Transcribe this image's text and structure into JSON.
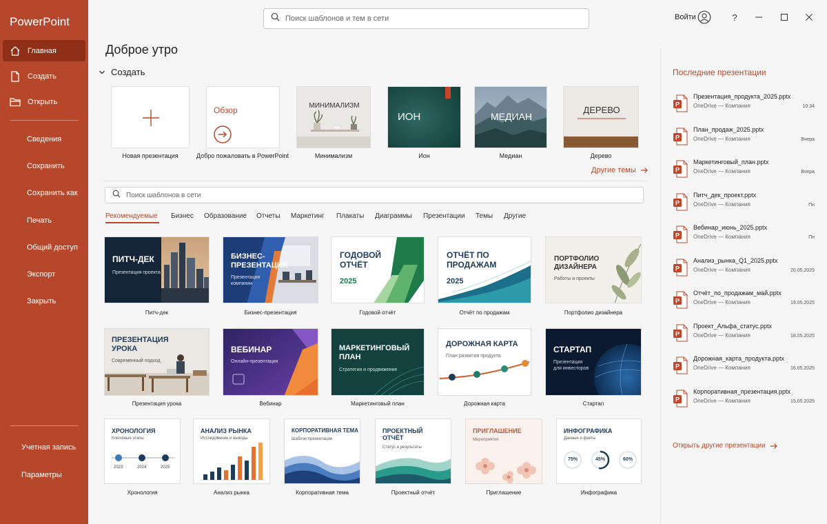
{
  "app": {
    "title": "PowerPoint"
  },
  "sidebar": {
    "home_label": "Главная",
    "new_label": "Создать",
    "open_label": "Открыть",
    "info_label": "Сведения",
    "save_label": "Сохранить",
    "save_as_label": "Сохранить как",
    "print_label": "Печать",
    "share_label": "Общий доступ",
    "export_label": "Экспорт",
    "close_label": "Закрыть",
    "account_label": "Учетная запись",
    "options_label": "Параметры"
  },
  "topbar": {
    "search_placeholder": "Поиск шаблонов и тем в сети",
    "signin_label": "Войти",
    "help_label": "?"
  },
  "main": {
    "greeting": "Доброе утро",
    "create_label": "Создать",
    "create_tiles": {
      "new": {
        "label": "Новая презентация"
      },
      "tour": {
        "label": "Добро пожаловать в PowerPoint",
        "title": "Обзор"
      },
      "minimal": {
        "label": "Минимализм",
        "title": "МИНИМАЛИЗМ"
      },
      "ion": {
        "label": "Ион",
        "title": "ИОН"
      },
      "median": {
        "label": "Медиан",
        "title": "МЕДИАН"
      },
      "wood": {
        "label": "Дерево",
        "title": "ДЕРЕВО"
      }
    },
    "other_themes_label": "Другие темы",
    "template_search_placeholder": "Поиск шаблонов в сети",
    "categories": [
      "Рекомендуемые",
      "Бизнес",
      "Образование",
      "Отчеты",
      "Маркетинг",
      "Плакаты",
      "Диаграммы",
      "Презентации",
      "Темы",
      "Другие"
    ],
    "templates": {
      "pitch": {
        "title": "ПИТЧ-ДЕК",
        "subtitle": "Презентация проекта",
        "label": "Питч-дек"
      },
      "business": {
        "title": "БИЗНЕС-\nПРЕЗЕНТАЦИЯ",
        "subtitle": "Презентация\nкомпании",
        "label": "Бизнес-презентация"
      },
      "annual": {
        "title": "ГОДОВОЙ\nОТЧЁТ",
        "year": "2025",
        "label": "Годовой отчёт"
      },
      "sales": {
        "title": "ОТЧЁТ ПО\nПРОДАЖАМ",
        "year": "2025",
        "label": "Отчёт по продажам"
      },
      "portfolio": {
        "title": "ПОРТФОЛИО\nДИЗАЙНЕРА",
        "subtitle": "Работы и проекты",
        "label": "Портфолио дизайнера"
      },
      "lesson": {
        "title": "ПРЕЗЕНТАЦИЯ\nУРОКА",
        "subtitle": "Современный подход",
        "label": "Презентация урока"
      },
      "webinar": {
        "title": "ВЕБИНАР",
        "subtitle": "Онлайн-презентация",
        "label": "Вебинар"
      },
      "marketing": {
        "title": "МАРКЕТИНГОВЫЙ\nПЛАН",
        "subtitle": "Стратегия и продвижение",
        "label": "Маркетинговый план"
      },
      "roadmap": {
        "title": "ДОРОЖНАЯ КАРТА",
        "subtitle": "План развития продукта",
        "label": "Дорожная карта"
      },
      "startup": {
        "title": "СТАРТАП",
        "subtitle": "Презентация\nдля инвесторов",
        "label": "Стартап"
      },
      "timeline": {
        "title": "ХРОНОЛОГИЯ",
        "subtitle": "Ключевые этапы",
        "years": [
          "2023",
          "2024",
          "2025"
        ],
        "label": "Хронология"
      },
      "market": {
        "title": "АНАЛИЗ РЫНКА",
        "subtitle": "Исследование и выводы",
        "label": "Анализ рынка"
      },
      "corporate": {
        "title": "КОРПОРАТИВНАЯ ТЕМА",
        "subtitle": "Шаблон презентации",
        "label": "Корпоративная тема"
      },
      "project": {
        "title": "ПРОЕКТНЫЙ\nОТЧЁТ",
        "subtitle": "Статус и результаты",
        "label": "Проектный отчёт"
      },
      "invitation": {
        "title": "ПРИГЛАШЕНИЕ",
        "subtitle": "Мероприятие",
        "label": "Приглашение"
      },
      "infographic": {
        "title": "ИНФОГРАФИКА",
        "subtitle": "Данные и факты",
        "values": [
          "75%",
          "45%",
          "60%"
        ],
        "label": "Инфографика"
      }
    }
  },
  "recent": {
    "title": "Последние презентации",
    "items": [
      {
        "name": "Презентация_продукта_2025.pptx",
        "location": "OneDrive — Компания",
        "date": "10:34"
      },
      {
        "name": "План_продаж_2025.pptx",
        "location": "OneDrive — Компания",
        "date": "Вчера"
      },
      {
        "name": "Маркетинговый_план.pptx",
        "location": "OneDrive — Компания",
        "date": "Вчера"
      },
      {
        "name": "Питч_дек_проект.pptx",
        "location": "OneDrive — Компания",
        "date": "Пн"
      },
      {
        "name": "Вебинар_июнь_2025.pptx",
        "location": "OneDrive — Компания",
        "date": "Пн"
      },
      {
        "name": "Анализ_рынка_Q1_2025.pptx",
        "location": "OneDrive — Компания",
        "date": "20.05.2025"
      },
      {
        "name": "Отчёт_по_продажам_май.pptx",
        "location": "OneDrive — Компания",
        "date": "19.05.2025"
      },
      {
        "name": "Проект_Альфа_статус.pptx",
        "location": "OneDrive — Компания",
        "date": "18.05.2025"
      },
      {
        "name": "Дорожная_карта_продукта.pptx",
        "location": "OneDrive — Компания",
        "date": "16.05.2025"
      },
      {
        "name": "Корпоративная_презентация.pptx",
        "location": "OneDrive — Компания",
        "date": "15.05.2025"
      }
    ],
    "open_other_label": "Открыть другие презентации"
  },
  "colors": {
    "accent": "#b7472a",
    "sidebar_active": "#8f2f18"
  }
}
